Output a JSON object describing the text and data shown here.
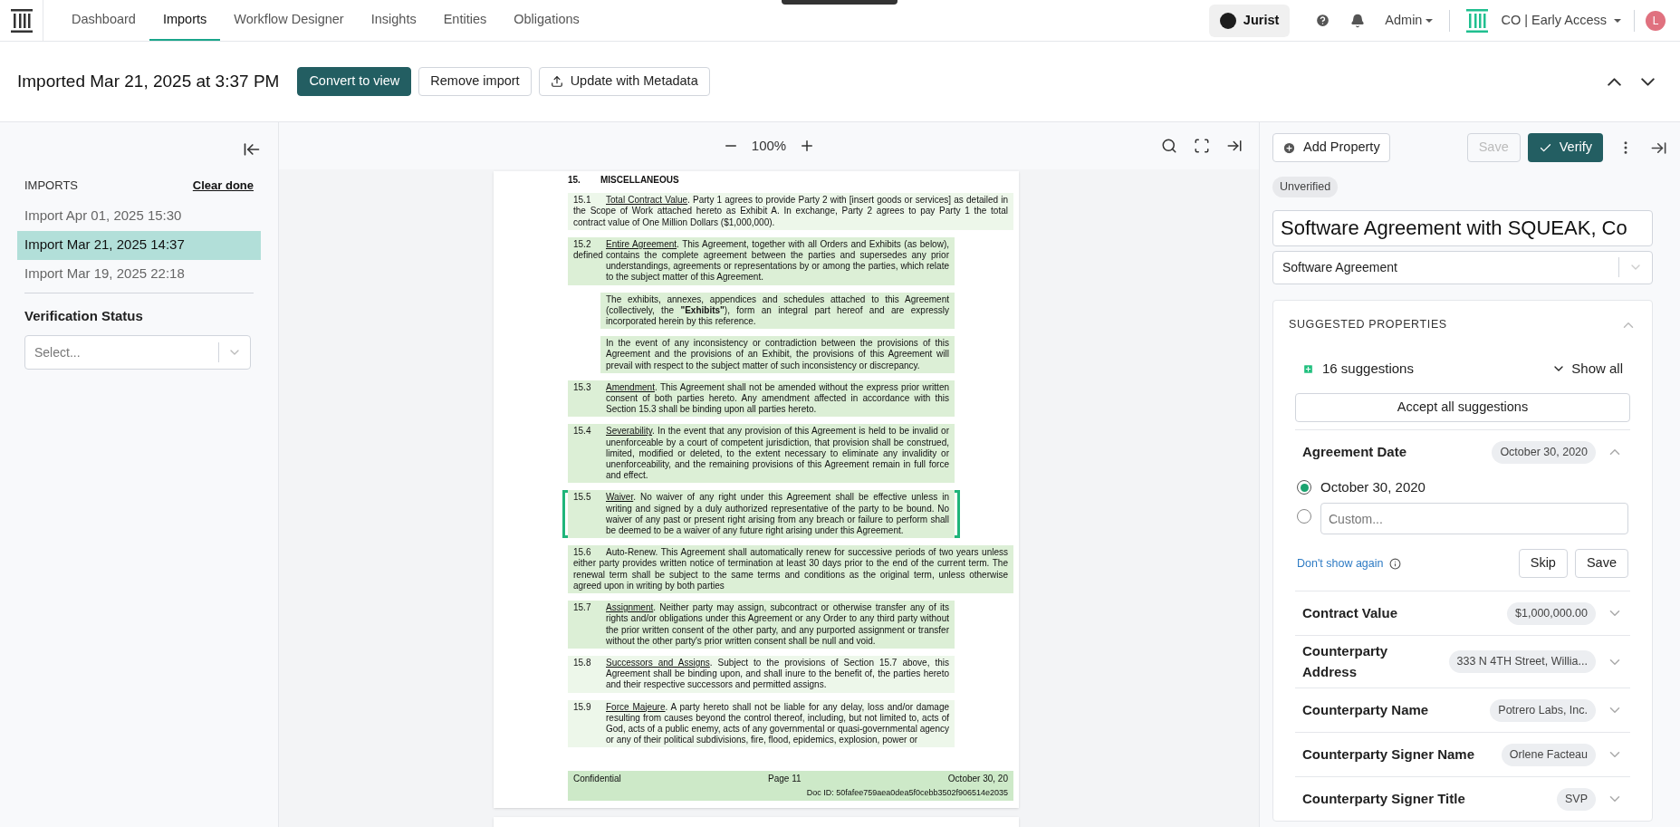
{
  "nav": {
    "tabs": [
      {
        "label": "Dashboard",
        "selected": false
      },
      {
        "label": "Imports",
        "selected": true
      },
      {
        "label": "Workflow Designer",
        "selected": false
      },
      {
        "label": "Insights",
        "selected": false
      },
      {
        "label": "Entities",
        "selected": false
      },
      {
        "label": "Obligations",
        "selected": false
      }
    ],
    "assistant": "Jurist",
    "account": "Admin",
    "workspace": "CO | Early Access",
    "avatar": "L"
  },
  "header": {
    "title": "Imported Mar 21, 2025 at 3:37 PM",
    "buttons": [
      {
        "label": "Convert to view",
        "kind": "primary"
      },
      {
        "label": "Remove import",
        "kind": "plain"
      },
      {
        "label": "Update with Metadata",
        "kind": "upload"
      }
    ]
  },
  "sidebar": {
    "heading": "IMPORTS",
    "clear": "Clear done",
    "imports": [
      {
        "label": "Import Apr 01, 2025 15:30",
        "selected": false
      },
      {
        "label": "Import Mar 21, 2025 14:37",
        "selected": true
      },
      {
        "label": "Import Mar 19, 2025 22:18",
        "selected": false
      }
    ],
    "filter_label": "Verification Status",
    "filter_placeholder": "Select..."
  },
  "viewer": {
    "zoom": "100%",
    "section_number": "15.",
    "section_title": "MISCELLANEOUS",
    "paragraphs": [
      {
        "kind": "flow",
        "number": "15.1",
        "heading": "Total Contract Value",
        "underlined": true,
        "text": ". Party 1 agrees to provide Party 2 with [insert goods or services] as detailed in the Scope of Work attached hereto as Exhibit A. In exchange, Party 2 agrees to pay Party 1 the total contract value of One Million Dollars ($1,000,000).",
        "color": "#edf7ea",
        "selected": false
      },
      {
        "kind": "numbered",
        "number": "15.2",
        "number_note": "defined",
        "heading": "Entire Agreement",
        "underlined": true,
        "text": ". This Agreement, together with all Orders and Exhibits (as below), contains the complete agreement between the parties and supersedes any prior understandings, agreements or representations by or among the parties, which relate to the subject matter of this Agreement.",
        "color": "#dcefd6",
        "selected": false
      },
      {
        "kind": "sub",
        "text": "The exhibits, annexes, appendices and schedules attached to this Agreement (collectively, the **\"Exhibits\"**), form an integral part hereof and are expressly incorporated herein by this reference.",
        "color": "#dcefd6",
        "selected": false
      },
      {
        "kind": "sub",
        "text": "In the event of any inconsistency or contradiction between the provisions of this Agreement and the provisions of an Exhibit, the provisions of this Agreement will prevail with respect to the subject matter of such inconsistency or discrepancy.",
        "color": "#dcefd6",
        "selected": false
      },
      {
        "kind": "numbered",
        "number": "15.3",
        "heading": "Amendment",
        "underlined": true,
        "text": ". This Agreement shall not be amended without the express prior written consent of both parties hereto. Any amendment affected in accordance with this Section 15.3 shall be binding upon all parties hereto.",
        "color": "#dcefd6",
        "selected": false
      },
      {
        "kind": "numbered",
        "number": "15.4",
        "heading": "Severability",
        "underlined": true,
        "text": ". In the event that any provision of this Agreement is held to be invalid or unenforceable by a court of competent jurisdiction, that provision shall be construed, limited, modified or deleted, to the extent necessary to eliminate any invalidity or unenforceability, and the remaining provisions of this Agreement remain in full force and effect.",
        "color": "#dcefd6",
        "selected": false
      },
      {
        "kind": "numbered",
        "number": "15.5",
        "heading": "Waiver",
        "underlined": true,
        "text": ". No waiver of any right under this Agreement shall be effective unless in writing and signed by a duly authorized representative of the party to be bound. No waiver of any past or present right arising from any breach or failure to perform shall be deemed to be a waiver of any future right arising under this Agreement.",
        "color": "#dcefd6",
        "selected": true
      },
      {
        "kind": "flow",
        "number": "15.6",
        "heading": "Auto-Renew",
        "underlined": false,
        "text": ". This Agreement shall automatically renew for successive periods of two years unless either party provides written notice of termination at least 30 days prior to the end of the current term. The renewal term shall be subject to the same terms and conditions as the original term, unless otherwise agreed upon in writing by both parties",
        "color": "#dcefd6",
        "selected": false
      },
      {
        "kind": "numbered",
        "number": "15.7",
        "heading": "Assignment",
        "underlined": true,
        "text": ". Neither party may assign, subcontract or otherwise transfer any of its rights and/or obligations under this Agreement or any Order to any third party without the prior written consent of the other party, and any purported assignment or transfer without the other party's prior written consent shall be null and void.",
        "color": "#dcefd6",
        "selected": false
      },
      {
        "kind": "numbered",
        "number": "15.8",
        "heading": "Successors and Assigns",
        "underlined": true,
        "text": ". Subject to the provisions of Section 15.7 above, this Agreement shall be binding upon, and shall inure to the benefit of, the parties hereto and their respective successors and permitted assigns.",
        "color": "#edf7ea",
        "selected": false
      },
      {
        "kind": "numbered",
        "number": "15.9",
        "heading": "Force Majeure",
        "underlined": true,
        "text": ". A party hereto shall not be liable for any delay, loss and/or damage resulting from causes beyond the control thereof, including, but not limited to, acts of God, acts of a public enemy, acts of any governmental or quasi-governmental agency or any of their political subdivisions, fire, flood, epidemics, explosion, power or",
        "color": "#edf7ea",
        "selected": false
      }
    ],
    "footer": {
      "left": "Confidential",
      "center": "Page 11",
      "right": "October 30, 20",
      "doc_id": "Doc ID: 50fafee759aea0dea5f0cebb3502f906514e2035"
    }
  },
  "panel": {
    "add": "Add Property",
    "save": "Save",
    "save_disabled": true,
    "verify": "Verify",
    "status": "Unverified",
    "title": "Software Agreement with SQUEAK, Co",
    "type": "Software Agreement",
    "suggested": {
      "heading": "SUGGESTED PROPERTIES",
      "count": "16 suggestions",
      "show_all": "Show all",
      "accept_all": "Accept all suggestions",
      "properties": [
        {
          "label": "Agreement Date",
          "value": "October 30, 2020",
          "expanded": true,
          "options": [
            {
              "kind": "value",
              "label": "October 30, 2020",
              "selected": true
            },
            {
              "kind": "custom",
              "placeholder": "Custom...",
              "selected": false
            }
          ],
          "dismiss": "Don't show again",
          "actions": [
            "Skip",
            "Save"
          ]
        },
        {
          "label": "Contract Value",
          "value": "$1,000,000.00",
          "expanded": false
        },
        {
          "label": "Counterparty Address",
          "value": "333 N 4TH Street, Willia...",
          "expanded": false
        },
        {
          "label": "Counterparty Name",
          "value": "Potrero Labs, Inc.",
          "expanded": false
        },
        {
          "label": "Counterparty Signer Name",
          "value": "Orlene Facteau",
          "expanded": false
        },
        {
          "label": "Counterparty Signer Title",
          "value": "SVP",
          "expanded": false
        }
      ]
    }
  }
}
